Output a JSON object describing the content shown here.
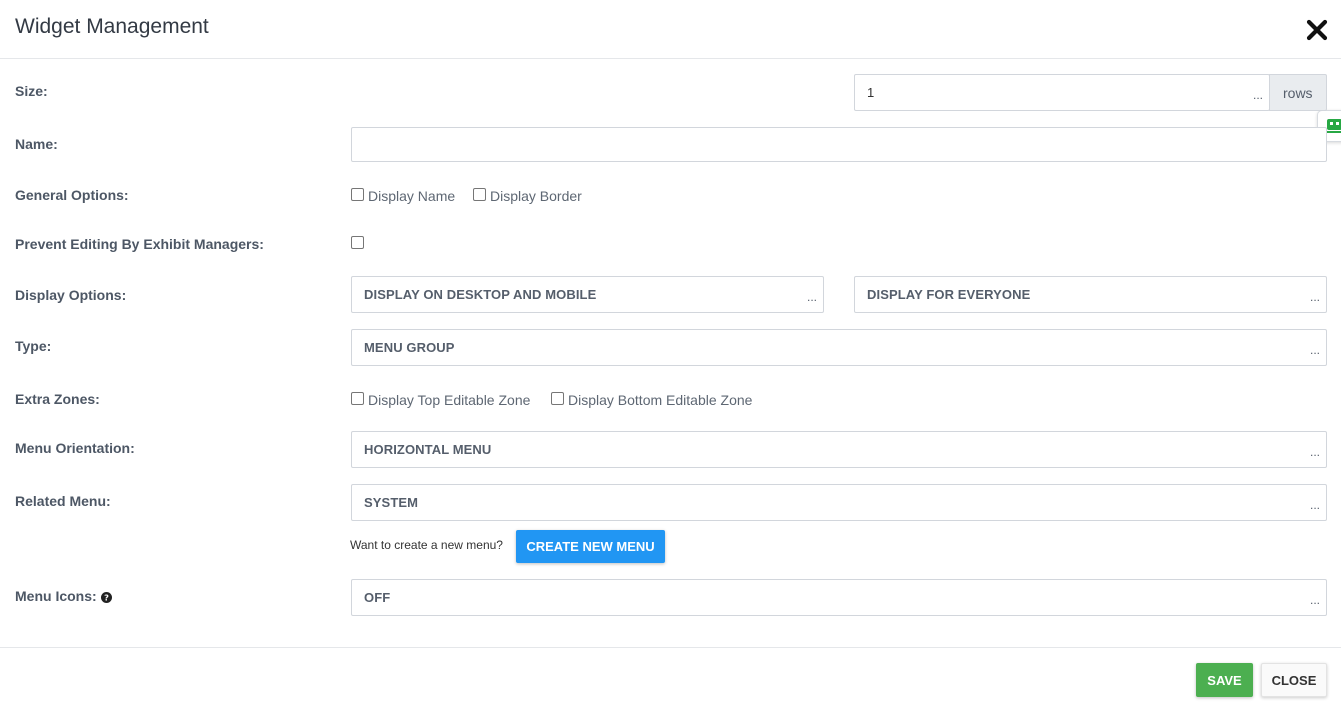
{
  "modal": {
    "title": "Widget Management",
    "close_icon": "close-x-icon"
  },
  "side_tab": {
    "icon": "robot-face-icon",
    "color": "#27a844"
  },
  "form": {
    "size": {
      "label": "Size:",
      "value": "1",
      "dots": "...",
      "addon": "rows"
    },
    "name": {
      "label": "Name:",
      "value": ""
    },
    "general_options": {
      "label": "General Options:",
      "options": [
        {
          "label": "Display Name",
          "checked": false
        },
        {
          "label": "Display Border",
          "checked": false
        }
      ]
    },
    "prevent_editing": {
      "label": "Prevent Editing By Exhibit Managers:",
      "checked": false
    },
    "display_options": {
      "label": "Display Options:",
      "device_value": "DISPLAY ON DESKTOP AND MOBILE",
      "audience_value": "DISPLAY FOR EVERYONE",
      "dots": "..."
    },
    "type": {
      "label": "Type:",
      "value": "MENU GROUP",
      "dots": "..."
    },
    "extra_zones": {
      "label": "Extra Zones:",
      "options": [
        {
          "label": "Display Top Editable Zone",
          "checked": false
        },
        {
          "label": "Display Bottom Editable Zone",
          "checked": false
        }
      ]
    },
    "menu_orientation": {
      "label": "Menu Orientation:",
      "value": "HORIZONTAL MENU",
      "dots": "..."
    },
    "related_menu": {
      "label": "Related Menu:",
      "value": "SYSTEM",
      "dots": "...",
      "helper_text": "Want to create a new menu?",
      "create_button": "CREATE NEW MENU"
    },
    "menu_icons": {
      "label": "Menu Icons:",
      "help_icon": "question-circle-icon",
      "value": "OFF",
      "dots": "..."
    }
  },
  "footer": {
    "save_label": "SAVE",
    "close_label": "CLOSE"
  },
  "colors": {
    "primary": "#2196f3",
    "success": "#4caf50",
    "border": "#d2d6dc"
  }
}
